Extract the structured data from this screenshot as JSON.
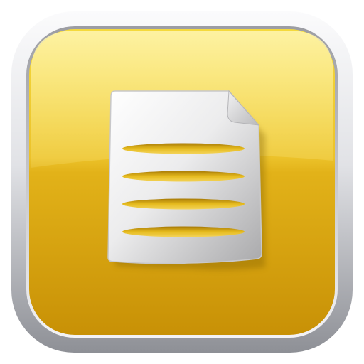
{
  "app_icon": {
    "icon": "document-icon",
    "colors": {
      "frame_light": "#f4f4f6",
      "frame_dark": "#8e9096",
      "tile_top": "#f7e472",
      "tile_mid": "#ecc52c",
      "tile_bottom": "#cf9a08",
      "paper_light": "#f6f6f6",
      "paper_shade": "#b9b9bb",
      "slot_yellow": "#d7a10f"
    }
  }
}
